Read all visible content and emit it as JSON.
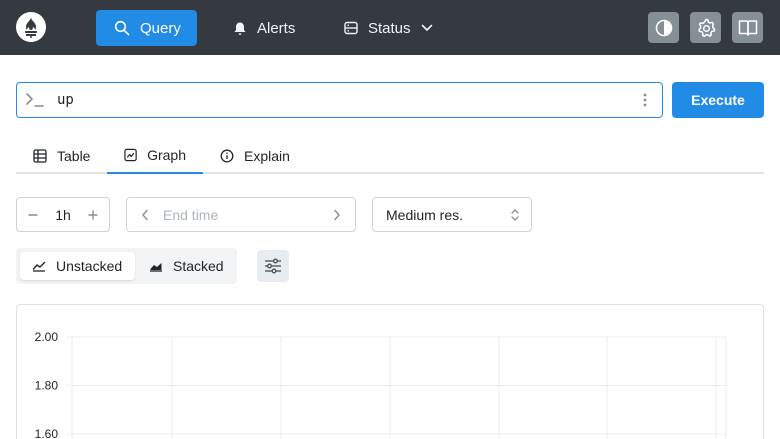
{
  "header": {
    "nav": [
      {
        "label": "Query",
        "icon": "search-icon",
        "active": true
      },
      {
        "label": "Alerts",
        "icon": "bell-icon",
        "active": false
      },
      {
        "label": "Status",
        "icon": "server-icon",
        "active": false
      }
    ],
    "icons": [
      "theme-toggle-icon",
      "settings-icon",
      "docs-book-icon"
    ]
  },
  "query": {
    "expression": "up",
    "execute_label": "Execute"
  },
  "tabs": [
    {
      "label": "Table",
      "icon": "table-icon"
    },
    {
      "label": "Graph",
      "icon": "chart-icon",
      "active": true
    },
    {
      "label": "Explain",
      "icon": "info-icon"
    }
  ],
  "controls": {
    "range": "1h",
    "end_time_placeholder": "End time",
    "resolution": "Medium res."
  },
  "stacking": {
    "unstacked_label": "Unstacked",
    "stacked_label": "Stacked",
    "selected": "Unstacked"
  },
  "chart_data": {
    "type": "line",
    "title": "",
    "xlabel": "",
    "ylabel": "",
    "y_ticks": [
      "2.00",
      "1.80",
      "1.60"
    ],
    "y_tick_values": [
      2.0,
      1.8,
      1.6
    ],
    "grid": true,
    "series": []
  },
  "colors": {
    "header_bg": "#343a40",
    "accent": "#228be6",
    "icon_btn_bg": "#868e96"
  }
}
